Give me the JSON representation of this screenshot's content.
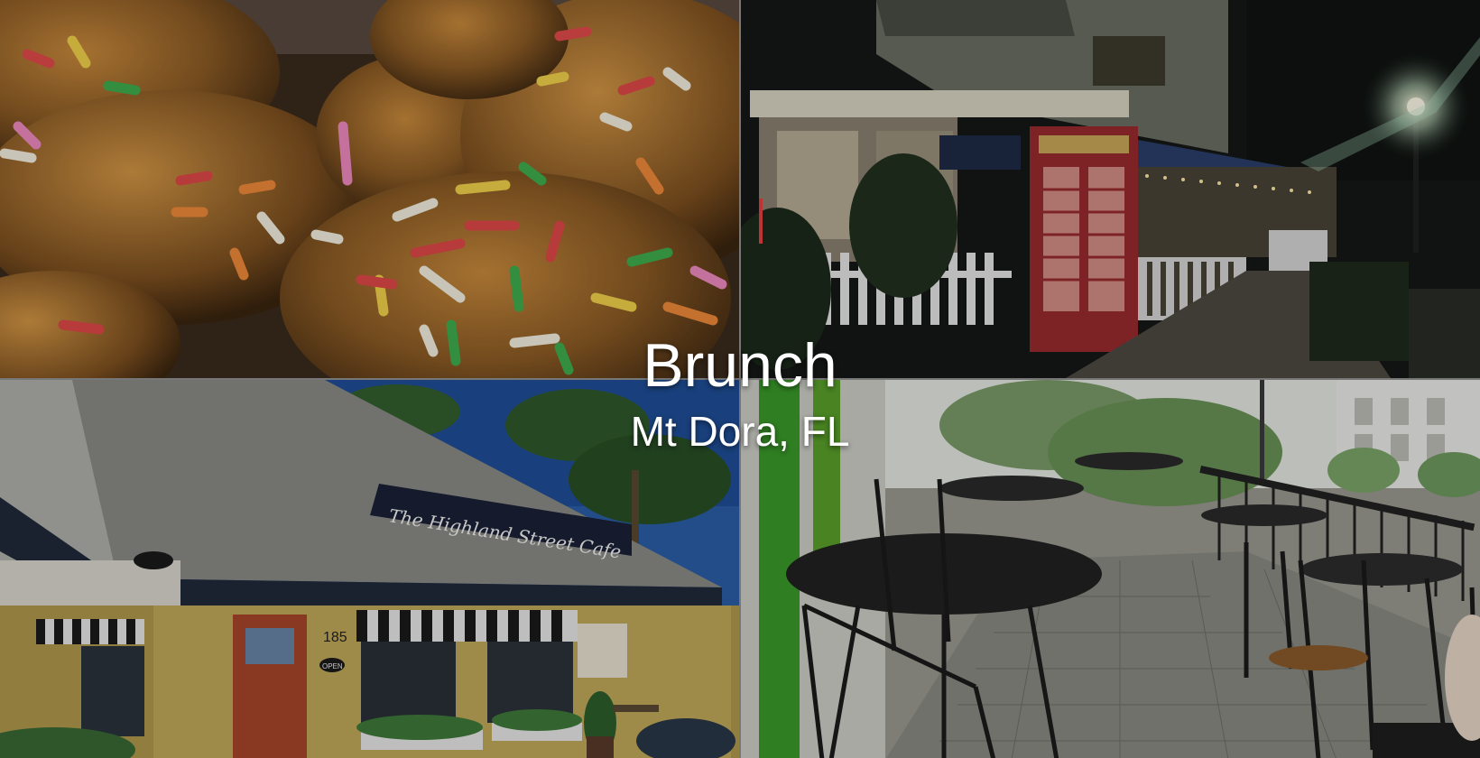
{
  "heading": {
    "title": "Brunch",
    "subtitle": "Mt Dora, FL"
  },
  "photos": [
    {
      "id": "donuts",
      "description": "close-up of glazed donut holes with rainbow sprinkles"
    },
    {
      "id": "night-storefront",
      "description": "storefront at night with red phone booth, white picket fence and string lights"
    },
    {
      "id": "cafe-exterior",
      "description": "daytime exterior of a yellow cafe building with dark awnings and a red door"
    },
    {
      "id": "patio-seating",
      "description": "outdoor patio with black wrought-iron tables and chairs"
    }
  ],
  "cafe_sign_text": "The Highland Street Cafe",
  "street_number": "185",
  "open_sign": "OPEN",
  "colors": {
    "title_text": "#ffffff",
    "divider": "#777777"
  }
}
